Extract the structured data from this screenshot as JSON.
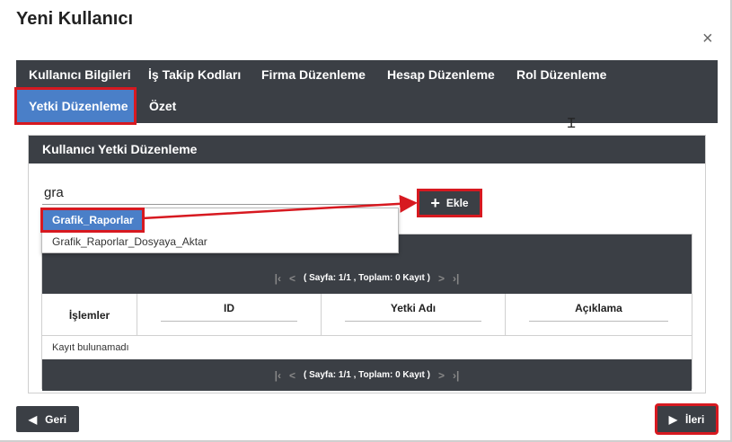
{
  "dialog": {
    "title": "Yeni Kullanıcı",
    "close_icon": "×"
  },
  "tabs": [
    {
      "label": "Kullanıcı Bilgileri"
    },
    {
      "label": "İş Takip Kodları"
    },
    {
      "label": "Firma Düzenleme"
    },
    {
      "label": "Hesap Düzenleme"
    },
    {
      "label": "Rol Düzenleme"
    },
    {
      "label": "Yetki Düzenleme",
      "active": true
    },
    {
      "label": "Özet"
    }
  ],
  "panel": {
    "title": "Kullanıcı Yetki Düzenleme",
    "search": {
      "value": "gra",
      "placeholder": ""
    },
    "suggestions": [
      "Grafik_Raporlar",
      "Grafik_Raporlar_Dosyaya_Aktar"
    ],
    "add_button": {
      "label": "Ekle",
      "icon": "plus-icon"
    }
  },
  "grid": {
    "pager_text": "( Sayfa: 1/1 , Toplam: 0 Kayıt )",
    "pager_icons": {
      "first": "⏮",
      "prev": "<",
      "next": ">",
      "last": "⏭"
    },
    "columns": [
      "İşlemler",
      "ID",
      "Yetki Adı",
      "Açıklama"
    ],
    "empty_text": "Kayıt bulunamadı"
  },
  "footer": {
    "back_label": "Geri",
    "next_label": "İleri"
  },
  "colors": {
    "dark": "#3b3f45",
    "accent": "#4a7fc8",
    "annotation": "#d71920"
  }
}
